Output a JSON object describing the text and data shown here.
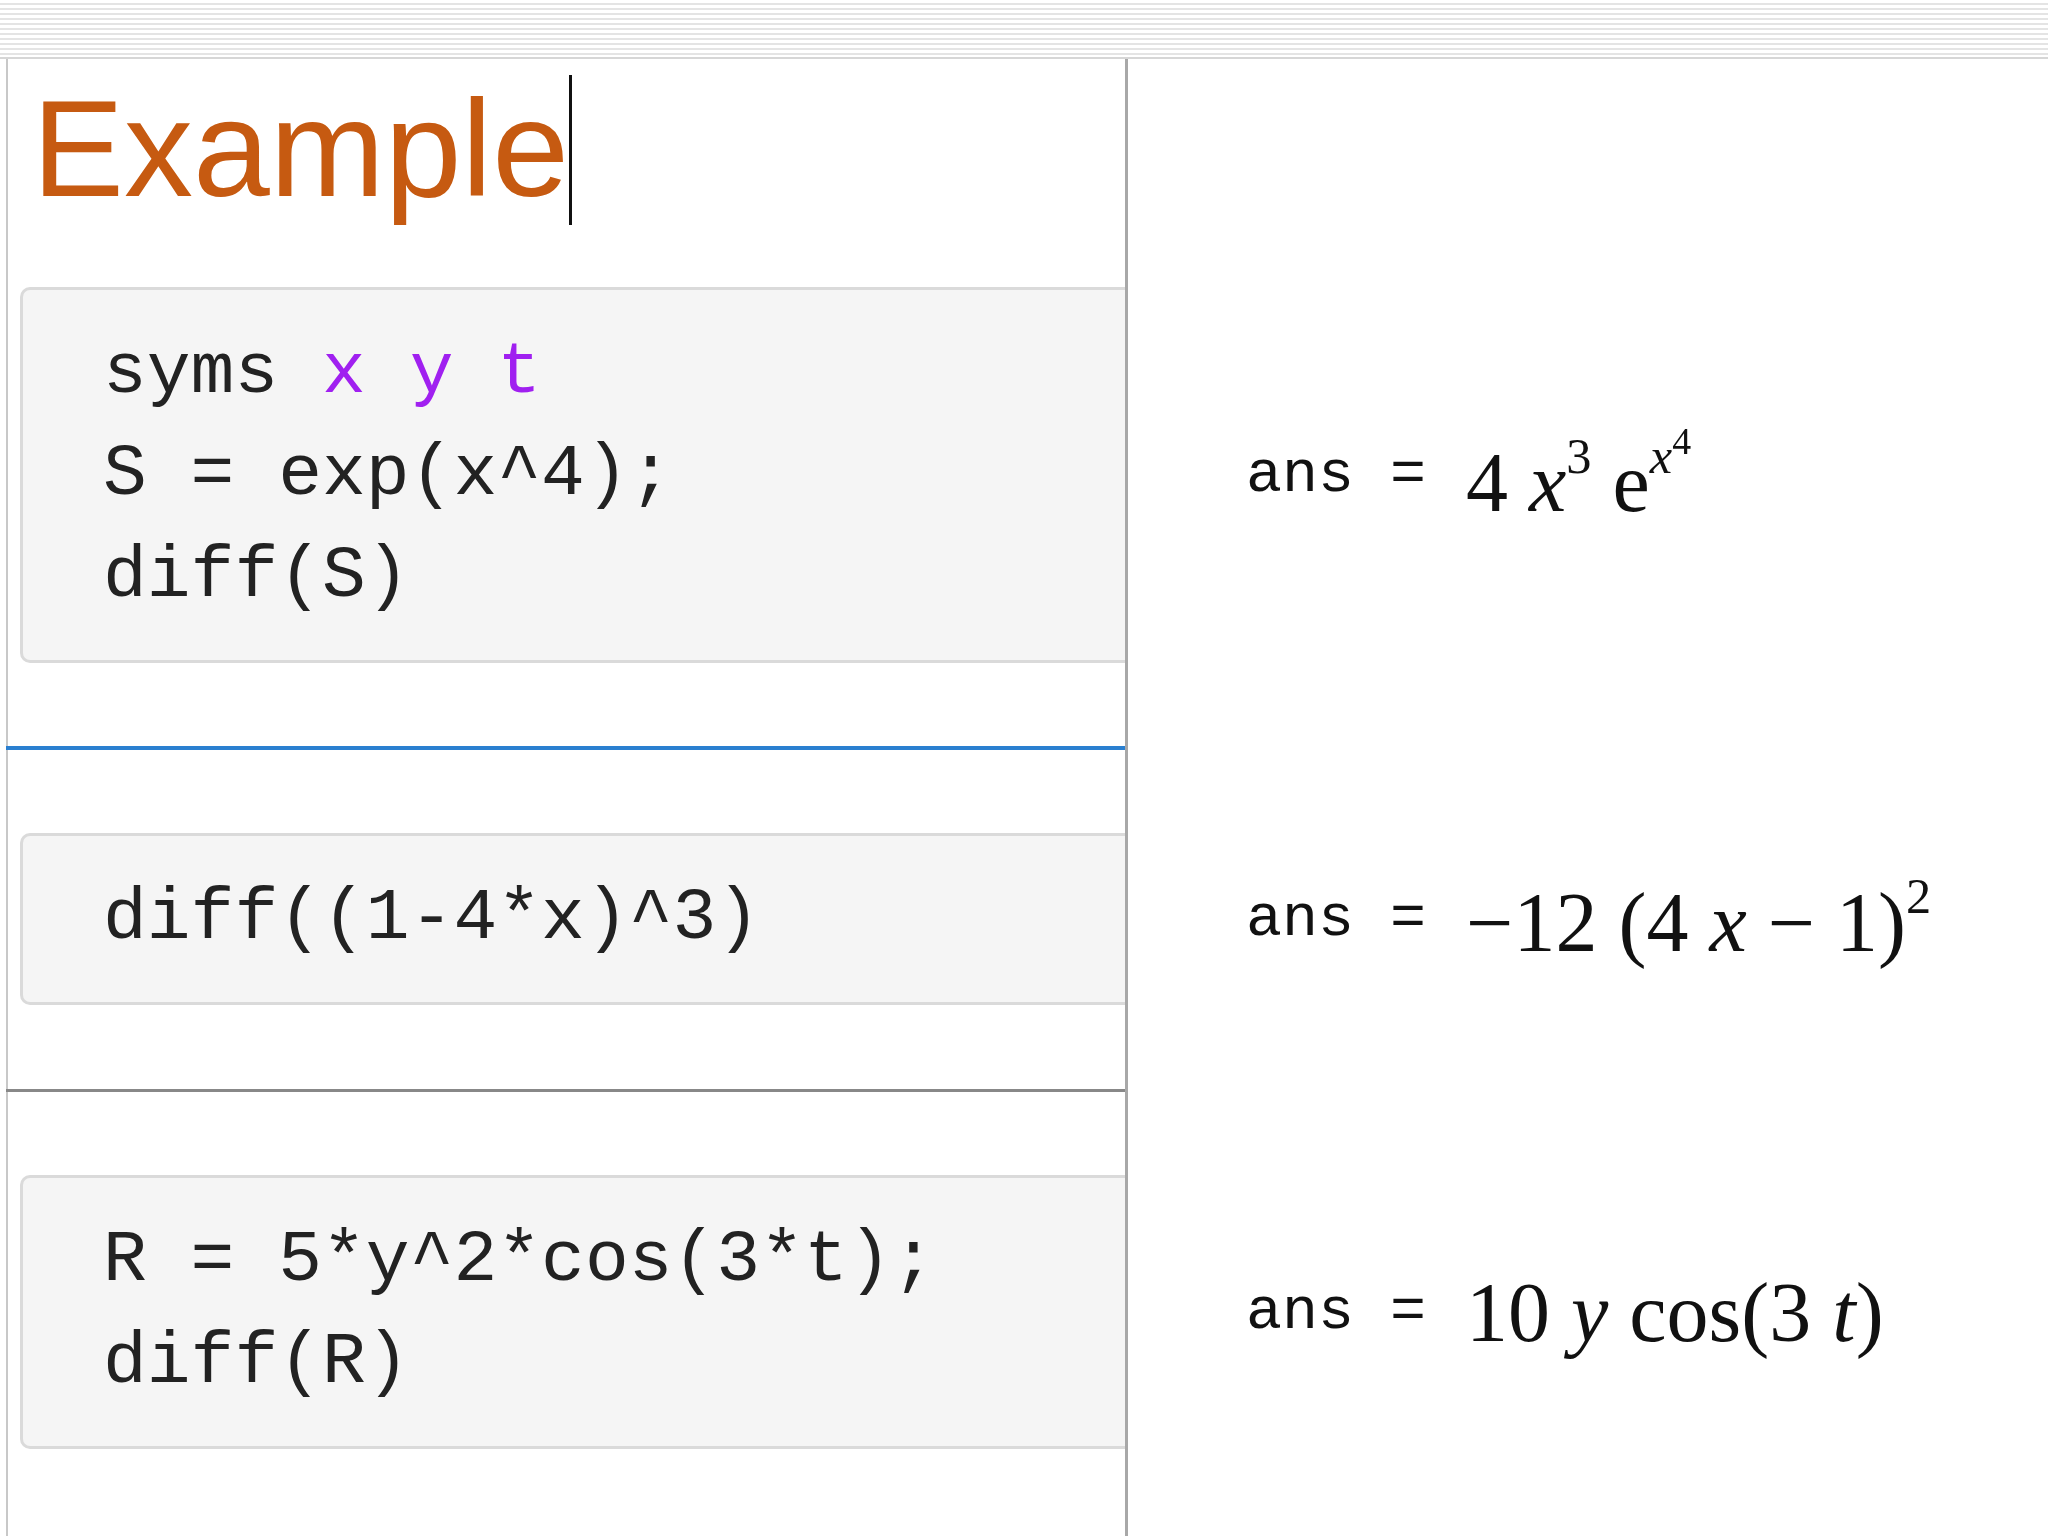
{
  "title": {
    "text": "Example",
    "cursor": true
  },
  "sections": [
    {
      "code": [
        [
          {
            "text": "syms ",
            "kind": "plain"
          },
          {
            "text": "x y t",
            "kind": "symbol"
          }
        ],
        [
          {
            "text": "S = exp(x^4);",
            "kind": "plain"
          }
        ],
        [
          {
            "text": "diff(S)",
            "kind": "plain"
          }
        ]
      ],
      "output": {
        "label": "ans =",
        "math": [
          {
            "text": "4 ",
            "kind": "plain"
          },
          {
            "text": "x",
            "kind": "var"
          },
          {
            "text": "3",
            "kind": "sup"
          },
          {
            "text": " e",
            "kind": "plain"
          },
          {
            "text": "x",
            "kind": "supvar"
          },
          {
            "text": "4",
            "kind": "supsup"
          }
        ]
      },
      "rule": {
        "focused": true
      }
    },
    {
      "code": [
        [
          {
            "text": "diff((1-4*x)^3)",
            "kind": "plain"
          }
        ]
      ],
      "output": {
        "label": "ans =",
        "math": [
          {
            "text": "−12 (4 ",
            "kind": "plain"
          },
          {
            "text": "x",
            "kind": "var"
          },
          {
            "text": " − 1)",
            "kind": "plain"
          },
          {
            "text": "2",
            "kind": "sup"
          }
        ]
      },
      "rule": {
        "focused": false
      }
    },
    {
      "code": [
        [
          {
            "text": "R = 5*y^2*cos(3*t);",
            "kind": "plain"
          }
        ],
        [
          {
            "text": "diff(R)",
            "kind": "plain"
          }
        ]
      ],
      "output": {
        "label": "ans =",
        "math": [
          {
            "text": "10 ",
            "kind": "plain"
          },
          {
            "text": "y",
            "kind": "var"
          },
          {
            "text": " cos(3 ",
            "kind": "plain"
          },
          {
            "text": "t",
            "kind": "var"
          },
          {
            "text": ")",
            "kind": "plain"
          }
        ]
      }
    }
  ]
}
